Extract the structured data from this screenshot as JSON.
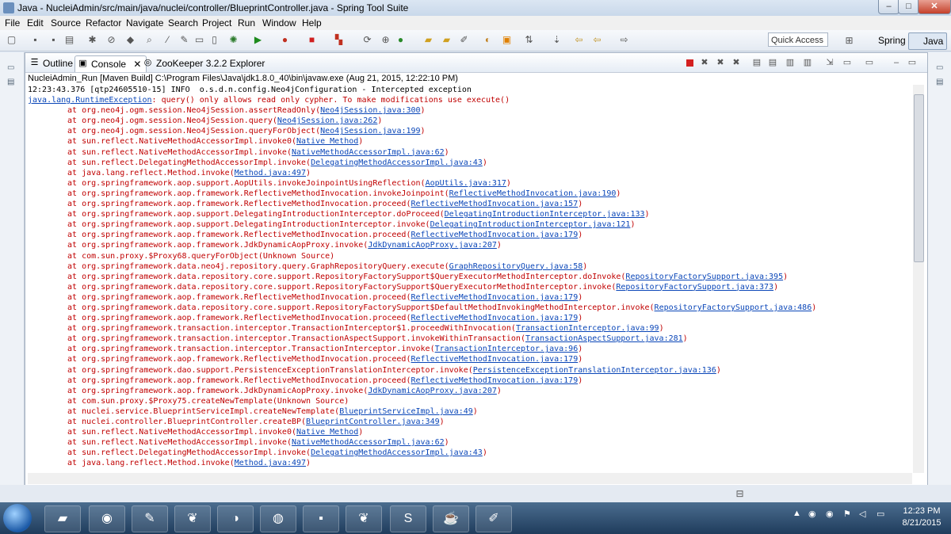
{
  "window": {
    "title": "Java - NucleiAdmin/src/main/java/nuclei/controller/BlueprintController.java - Spring Tool Suite",
    "controls": [
      "–",
      "□",
      "✕"
    ]
  },
  "menu": [
    "File",
    "Edit",
    "Source",
    "Refactor",
    "Navigate",
    "Search",
    "Project",
    "Run",
    "Window",
    "Help"
  ],
  "toolbar": {
    "quick_access_placeholder": "Quick Access",
    "perspectives": [
      "Spring",
      "Java"
    ]
  },
  "view": {
    "tabs": [
      "Outline",
      "Console",
      "ZooKeeper 3.2.2 Explorer"
    ],
    "active_tab": "Console",
    "launch": "NucleiAdmin_Run [Maven Build] C:\\Program Files\\Java\\jdk1.8.0_40\\bin\\javaw.exe (Aug 21, 2015, 12:22:10 PM)"
  },
  "console": {
    "info_line": "12:23:43.376 [qtp24605510-15] INFO  o.s.d.n.config.Neo4jConfiguration - Intercepted exception",
    "exception_link": "java.lang.RuntimeException",
    "exception_msg": ": query() only allows read only cypher. To make modifications use execute()",
    "frames": [
      {
        "m": "org.neo4j.ogm.session.Neo4jSession.assertReadOnly",
        "s": "Neo4jSession.java:300"
      },
      {
        "m": "org.neo4j.ogm.session.Neo4jSession.query",
        "s": "Neo4jSession.java:262"
      },
      {
        "m": "org.neo4j.ogm.session.Neo4jSession.queryForObject",
        "s": "Neo4jSession.java:199"
      },
      {
        "m": "sun.reflect.NativeMethodAccessorImpl.invoke0",
        "s": "Native Method"
      },
      {
        "m": "sun.reflect.NativeMethodAccessorImpl.invoke",
        "s": "NativeMethodAccessorImpl.java:62"
      },
      {
        "m": "sun.reflect.DelegatingMethodAccessorImpl.invoke",
        "s": "DelegatingMethodAccessorImpl.java:43"
      },
      {
        "m": "java.lang.reflect.Method.invoke",
        "s": "Method.java:497"
      },
      {
        "m": "org.springframework.aop.support.AopUtils.invokeJoinpointUsingReflection",
        "s": "AopUtils.java:317"
      },
      {
        "m": "org.springframework.aop.framework.ReflectiveMethodInvocation.invokeJoinpoint",
        "s": "ReflectiveMethodInvocation.java:190"
      },
      {
        "m": "org.springframework.aop.framework.ReflectiveMethodInvocation.proceed",
        "s": "ReflectiveMethodInvocation.java:157"
      },
      {
        "m": "org.springframework.aop.support.DelegatingIntroductionInterceptor.doProceed",
        "s": "DelegatingIntroductionInterceptor.java:133"
      },
      {
        "m": "org.springframework.aop.support.DelegatingIntroductionInterceptor.invoke",
        "s": "DelegatingIntroductionInterceptor.java:121"
      },
      {
        "m": "org.springframework.aop.framework.ReflectiveMethodInvocation.proceed",
        "s": "ReflectiveMethodInvocation.java:179"
      },
      {
        "m": "org.springframework.aop.framework.JdkDynamicAopProxy.invoke",
        "s": "JdkDynamicAopProxy.java:207"
      },
      {
        "m": "com.sun.proxy.$Proxy68.queryForObject",
        "s": "Unknown Source",
        "plain": true
      },
      {
        "m": "org.springframework.data.neo4j.repository.query.GraphRepositoryQuery.execute",
        "s": "GraphRepositoryQuery.java:58"
      },
      {
        "m": "org.springframework.data.repository.core.support.RepositoryFactorySupport$QueryExecutorMethodInterceptor.doInvoke",
        "s": "RepositoryFactorySupport.java:395"
      },
      {
        "m": "org.springframework.data.repository.core.support.RepositoryFactorySupport$QueryExecutorMethodInterceptor.invoke",
        "s": "RepositoryFactorySupport.java:373"
      },
      {
        "m": "org.springframework.aop.framework.ReflectiveMethodInvocation.proceed",
        "s": "ReflectiveMethodInvocation.java:179"
      },
      {
        "m": "org.springframework.data.repository.core.support.RepositoryFactorySupport$DefaultMethodInvokingMethodInterceptor.invoke",
        "s": "RepositoryFactorySupport.java:486"
      },
      {
        "m": "org.springframework.aop.framework.ReflectiveMethodInvocation.proceed",
        "s": "ReflectiveMethodInvocation.java:179"
      },
      {
        "m": "org.springframework.transaction.interceptor.TransactionInterceptor$1.proceedWithInvocation",
        "s": "TransactionInterceptor.java:99"
      },
      {
        "m": "org.springframework.transaction.interceptor.TransactionAspectSupport.invokeWithinTransaction",
        "s": "TransactionAspectSupport.java:281"
      },
      {
        "m": "org.springframework.transaction.interceptor.TransactionInterceptor.invoke",
        "s": "TransactionInterceptor.java:96"
      },
      {
        "m": "org.springframework.aop.framework.ReflectiveMethodInvocation.proceed",
        "s": "ReflectiveMethodInvocation.java:179"
      },
      {
        "m": "org.springframework.dao.support.PersistenceExceptionTranslationInterceptor.invoke",
        "s": "PersistenceExceptionTranslationInterceptor.java:136"
      },
      {
        "m": "org.springframework.aop.framework.ReflectiveMethodInvocation.proceed",
        "s": "ReflectiveMethodInvocation.java:179"
      },
      {
        "m": "org.springframework.aop.framework.JdkDynamicAopProxy.invoke",
        "s": "JdkDynamicAopProxy.java:207"
      },
      {
        "m": "com.sun.proxy.$Proxy75.createNewTemplate",
        "s": "Unknown Source",
        "plain": true
      },
      {
        "m": "nuclei.service.BlueprintServiceImpl.createNewTemplate",
        "s": "BlueprintServiceImpl.java:49"
      },
      {
        "m": "nuclei.controller.BlueprintController.createBP",
        "s": "BlueprintController.java:349"
      },
      {
        "m": "sun.reflect.NativeMethodAccessorImpl.invoke0",
        "s": "Native Method"
      },
      {
        "m": "sun.reflect.NativeMethodAccessorImpl.invoke",
        "s": "NativeMethodAccessorImpl.java:62"
      },
      {
        "m": "sun.reflect.DelegatingMethodAccessorImpl.invoke",
        "s": "DelegatingMethodAccessorImpl.java:43"
      },
      {
        "m": "java.lang.reflect.Method.invoke",
        "s": "Method.java:497"
      }
    ]
  },
  "taskbar": {
    "time": "12:23 PM",
    "date": "8/21/2015"
  },
  "colors": {
    "error_text": "#c00000",
    "link": "#0a46b8"
  }
}
